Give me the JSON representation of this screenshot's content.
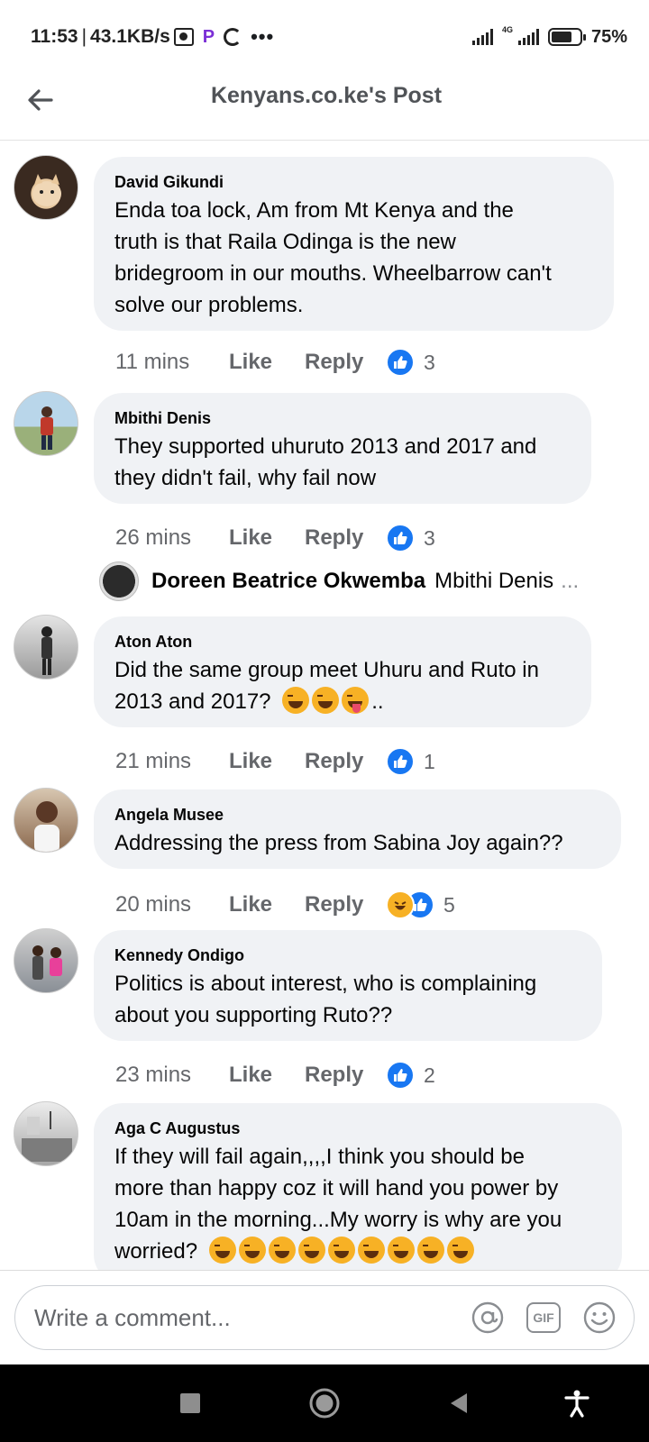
{
  "status_bar": {
    "time": "11:53",
    "separator": "|",
    "speed": "43.1KB/s",
    "more": "•••",
    "network_tag": "4G",
    "battery_pct": "75%",
    "battery_level": 0.75
  },
  "header": {
    "title": "Kenyans.co.ke's Post"
  },
  "comments": [
    {
      "name": "David Gikundi",
      "lines": [
        "Enda toa lock, Am from Mt Kenya and the",
        "truth is that Raila Odinga is the new",
        "bridegroom in our mouths. Wheelbarrow can't",
        "solve our problems."
      ],
      "time": "11 mins",
      "like": "Like",
      "reply": "Reply",
      "reactions": "3"
    },
    {
      "name": "Mbithi Denis",
      "lines": [
        "They supported uhuruto 2013 and 2017 and",
        "they didn't fail, why fail now"
      ],
      "time": "26 mins",
      "like": "Like",
      "reply": "Reply",
      "reactions": "3"
    },
    {
      "name": "Aton Aton",
      "lines": [
        "Did the same group meet Uhuru and Ruto in",
        "2013 and 2017?"
      ],
      "trailing": "..",
      "time": "21 mins",
      "like": "Like",
      "reply": "Reply",
      "reactions": "1"
    },
    {
      "name": "Angela Musee",
      "lines": [
        "Addressing the press from Sabina Joy again??"
      ],
      "time": "20 mins",
      "like": "Like",
      "reply": "Reply",
      "reactions": "5"
    },
    {
      "name": "Kennedy Ondigo",
      "lines": [
        "Politics is about interest, who is complaining",
        "about you supporting Ruto??"
      ],
      "time": "23 mins",
      "like": "Like",
      "reply": "Reply",
      "reactions": "2"
    },
    {
      "name": "Aga C Augustus",
      "lines": [
        "If they will fail again,,,,I think you should be",
        "more than happy coz it will hand you power by",
        "10am in the morning...My worry is why are you",
        "worried?"
      ]
    }
  ],
  "reply_preview": {
    "name": "Doreen Beatrice Okwemba",
    "snippet": "Mbithi Denis",
    "ellipsis": "..."
  },
  "composer": {
    "placeholder": "Write a comment...",
    "gif_label": "GIF"
  },
  "colors": {
    "like_blue": "#1877f2",
    "bubble_gray": "#f0f2f5",
    "meta_gray": "#65676b"
  },
  "icons": {
    "back": "arrow-left-icon",
    "mention": "at-sign-icon",
    "gif": "gif-icon",
    "emoji": "smiley-icon",
    "like": "thumbs-up-icon",
    "haha": "laughing-face-icon"
  }
}
